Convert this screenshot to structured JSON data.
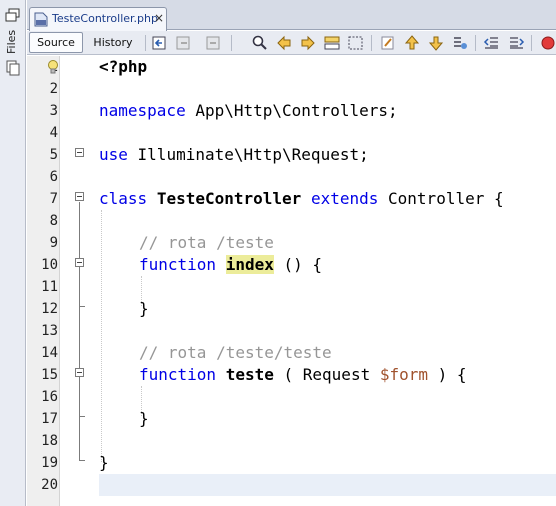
{
  "sidebar": {
    "label": "Files"
  },
  "tab": {
    "file_name": "TesteController.php",
    "close": "×"
  },
  "toolbar": {
    "source_label": "Source",
    "history_label": "History"
  },
  "editor": {
    "line_numbers": [
      "1",
      "2",
      "3",
      "4",
      "5",
      "6",
      "7",
      "8",
      "9",
      "10",
      "11",
      "12",
      "13",
      "14",
      "15",
      "16",
      "17",
      "18",
      "19",
      "20"
    ],
    "lines": {
      "l1": "<?php",
      "l3_kw": "namespace",
      "l3_rest": " App\\Http\\Controllers;",
      "l5_kw": "use",
      "l5_rest": " Illuminate\\Http\\Request;",
      "l7_kw1": "class",
      "l7_name": "TesteController",
      "l7_kw2": "extends",
      "l7_rest": " Controller {",
      "l9_comment": "// rota /teste",
      "l10_kw": "function",
      "l10_name": "index",
      "l10_rest": " () {",
      "l12": "}",
      "l14_comment": "// rota /teste/teste",
      "l15_kw": "function",
      "l15_name": "teste",
      "l15_mid": " ( Request ",
      "l15_var": "$form",
      "l15_end": " ) {",
      "l17": "}",
      "l19": "}"
    }
  },
  "colors": {
    "keyword": "#0000e6",
    "comment": "#969696",
    "variable": "#a0522d",
    "highlight": "#ecec9a",
    "current_line": "#e9eff8"
  }
}
